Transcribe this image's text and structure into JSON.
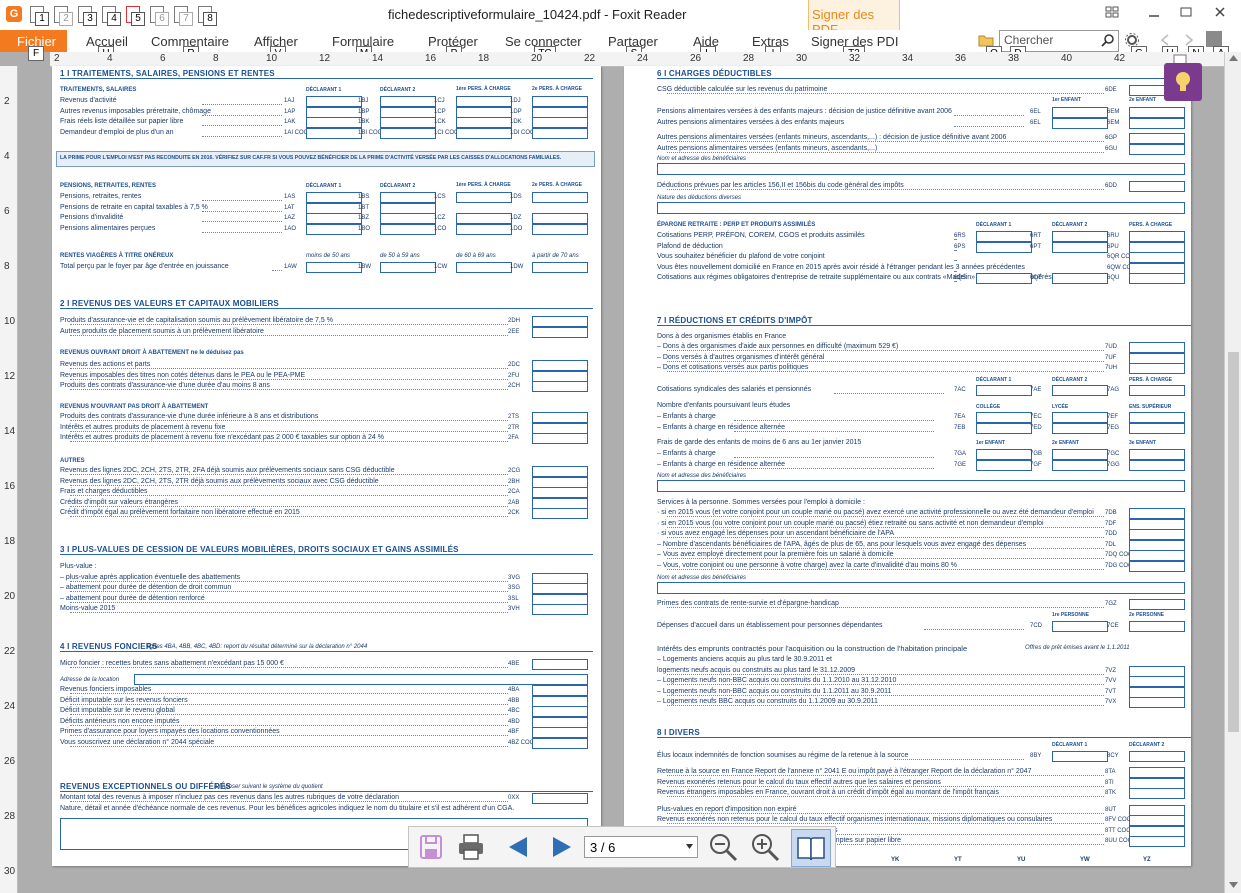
{
  "window": {
    "title": "fichedescriptiveformulaire_10424.pdf - Foxit Reader",
    "sign_tab": "Signer des PDF",
    "app_icon_letter": "G"
  },
  "qat_keys": [
    "1",
    "2",
    "3",
    "4",
    "5",
    "6",
    "7",
    "8"
  ],
  "menu": {
    "fichier": "Fichier",
    "items": [
      "Accueil",
      "Commentaire",
      "Afficher",
      "Formulaire",
      "Protéger",
      "Se connecter",
      "Partager",
      "Aide",
      "Extras",
      "Signer des PDI"
    ]
  },
  "menu_keytips": [
    "F",
    "H",
    "R",
    "V",
    "M",
    "P",
    "TC",
    "S",
    "L",
    "I",
    "T3",
    "Q",
    "D",
    "G",
    "U",
    "N",
    "A"
  ],
  "search": {
    "placeholder": "Chercher"
  },
  "ruler": {
    "h_ticks": [
      "2",
      "4",
      "6",
      "8",
      "10",
      "12",
      "14",
      "16",
      "18",
      "20",
      "22",
      "24",
      "26",
      "28",
      "30",
      "32",
      "34",
      "36",
      "38",
      "40",
      "42"
    ],
    "v_ticks": [
      "2",
      "4",
      "6",
      "8",
      "10",
      "12",
      "14",
      "16",
      "18",
      "20",
      "22",
      "24",
      "26",
      "28",
      "30"
    ]
  },
  "left_page": {
    "s1_title": "1 I TRAITEMENTS, SALAIRES, PENSIONS ET RENTES",
    "s1_sub": "TRAITEMENTS, SALAIRES",
    "col_heads": [
      "DÉCLARANT 1",
      "DÉCLARANT 2",
      "1ère PERS. À CHARGE",
      "2e PERS. À CHARGE"
    ],
    "s1_rows": [
      {
        "label": "Revenus d'activité",
        "codes": [
          "1AJ",
          "1BJ",
          "1CJ",
          "1DJ"
        ]
      },
      {
        "label": "Autres revenus imposables préretraite, chômage",
        "codes": [
          "1AP",
          "1BP",
          "1CP",
          "1DP"
        ]
      },
      {
        "label": "Frais réels liste détaillée sur papier libre",
        "codes": [
          "1AK",
          "1BK",
          "1CK",
          "1DK"
        ]
      },
      {
        "label": "Demandeur d'emploi de plus d'un an",
        "codes": [
          "1AI COCHEZ",
          "1BI COCHEZ",
          "1CI COCHEZ",
          "1DI COCHEZ"
        ]
      }
    ],
    "prime_note": "LA PRIME POUR L'EMPLOI N'EST PAS RECONDUITE EN 2016. VÉRIFIEZ SUR CAF.FR SI VOUS POUVEZ BÉNÉFICIER DE LA PRIME D'ACTIVITÉ VERSÉE PAR LES CAISSES D'ALLOCATIONS FAMILIALES.",
    "pensions_sub": "PENSIONS, RETRAITES, RENTES",
    "pensions_rows": [
      {
        "label": "Pensions, retraites, rentes",
        "codes": [
          "1AS",
          "1BS",
          "1CS",
          "1DS"
        ]
      },
      {
        "label": "Pensions de retraite en capital taxables à 7,5 %",
        "codes": [
          "1AT",
          "1BT",
          "",
          ""
        ]
      },
      {
        "label": "Pensions d'invalidité",
        "codes": [
          "1AZ",
          "1BZ",
          "1CZ",
          "1DZ"
        ]
      },
      {
        "label": "Pensions alimentaires perçues",
        "codes": [
          "1AO",
          "1BO",
          "1CO",
          "1DO"
        ]
      }
    ],
    "rentes_sub": "RENTES VIAGÈRES À TITRE ONÉREUX",
    "rentes_cols": [
      "moins de 50 ans",
      "de 50 à 59 ans",
      "de 60 à 69 ans",
      "à partir de 70 ans"
    ],
    "rentes_row": {
      "label": "Total perçu par le foyer par âge d'entrée en jouissance",
      "codes": [
        "1AW",
        "1BW",
        "1CW",
        "1DW"
      ]
    },
    "s2_title": "2 I REVENUS DES VALEURS ET CAPITAUX MOBILIERS",
    "s2_rows_a": [
      {
        "label": "Produits d'assurance-vie et de capitalisation soumis au prélèvement libératoire de 7,5 %",
        "code": "2DH"
      },
      {
        "label": "Autres produits de placement soumis à un prélèvement libératoire",
        "code": "2EE"
      }
    ],
    "s2_sub_b": "REVENUS OUVRANT DROIT À ABATTEMENT ne le déduisez pas",
    "s2_rows_b": [
      {
        "label": "Revenus des actions et parts",
        "code": "2DC"
      },
      {
        "label": "Revenus imposables des titres non cotés détenus dans le PEA ou le PEA-PME",
        "code": "2FU"
      },
      {
        "label": "Produits des contrats d'assurance-vie d'une durée d'au moins 8 ans",
        "code": "2CH"
      }
    ],
    "s2_sub_c": "REVENUS N'OUVRANT PAS DROIT À ABATTEMENT",
    "s2_rows_c": [
      {
        "label": "Produits des contrats d'assurance-vie d'une durée inférieure à 8 ans et distributions",
        "code": "2TS"
      },
      {
        "label": "Intérêts et autres produits de placement à revenu fixe",
        "code": "2TR"
      },
      {
        "label": "Intérêts et autres produits de placement à revenu fixe n'excédant pas 2 000 € taxables sur option à 24 %",
        "code": "2FA"
      }
    ],
    "s2_sub_d": "AUTRES",
    "s2_rows_d": [
      {
        "label": "Revenus des lignes 2DC, 2CH, 2TS, 2TR, 2FA déjà soumis aux prélèvements sociaux sans CSG déductible",
        "code": "2CG"
      },
      {
        "label": "Revenus des lignes 2DC, 2CH, 2TS, 2TR déjà soumis aux prélèvements sociaux avec CSG déductible",
        "code": "2BH"
      },
      {
        "label": "Frais et charges déductibles",
        "code": "2CA"
      },
      {
        "label": "Crédits d'impôt sur valeurs étrangères",
        "code": "2AB"
      },
      {
        "label": "Crédit d'impôt égal au prélèvement forfaitaire non libératoire effectué en 2015",
        "code": "2CK"
      }
    ],
    "s3_title": "3 I PLUS-VALUES DE CESSION DE VALEURS MOBILIÈRES, DROITS SOCIAUX ET GAINS ASSIMILÉS",
    "s3_rows": [
      {
        "label": "Plus-value :",
        "code": ""
      },
      {
        "label": "– plus-value après application éventuelle des abattements",
        "code": "3VG"
      },
      {
        "label": "– abattement pour durée de détention de droit commun",
        "code": "3SG"
      },
      {
        "label": "– abattement pour durée de détention renforcé",
        "code": "3SL"
      },
      {
        "label": "Moins-value 2015",
        "code": "3VH"
      }
    ],
    "s4_title": "4 I REVENUS FONCIERS",
    "s4_title_note": "lignes 4BA, 4BB, 4BC, 4BD: report du résultat déterminé sur la déclaration n° 2044",
    "s4_micro": {
      "label": "Micro foncier : recettes brutes sans abattement n'excédant pas 15 000 €",
      "code": "4BE"
    },
    "s4_address": "Adresse de la location",
    "s4_rows": [
      {
        "label": "Revenus fonciers imposables",
        "code": "4BA"
      },
      {
        "label": "Déficit imputable sur les revenus fonciers",
        "code": "4BB"
      },
      {
        "label": "Déficit imputable sur le revenu global",
        "code": "4BC"
      },
      {
        "label": "Déficits antérieurs non encore imputés",
        "code": "4BD"
      },
      {
        "label": "Primes d'assurance pour loyers impayés des locations conventionnées",
        "code": "4BF"
      },
      {
        "label": "Vous souscrivez une déclaration n° 2044 spéciale",
        "code": "4BZ COCHEZ"
      }
    ],
    "s5_title": "REVENUS EXCEPTIONNELS OU DIFFÉRÉS",
    "s5_title_note": "à imposer suivant le système du quotient",
    "s5_rows": [
      {
        "label": "Montant total des revenus à imposer n'incluez pas ces revenus dans les autres rubriques de votre déclaration",
        "code": "0XX"
      },
      {
        "label": "Nature, détail et année d'échéance normale de ces revenus. Pour les bénéfices agricoles indiquez le nom du titulaire et s'il est adhérent d'un CGA.",
        "code": ""
      }
    ]
  },
  "right_page": {
    "s6_title": "6 I CHARGES DÉDUCTIBLES",
    "csg": {
      "label": "CSG déductible calculée sur les revenus du patrimoine",
      "code": "6DE"
    },
    "enfant_cols": [
      "1er ENFANT",
      "2e ENFANT"
    ],
    "pensions_majeurs": [
      {
        "label": "Pensions alimentaires versées à des enfants majeurs : décision de justice définitive avant 2006",
        "codes": [
          "6EL",
          "6EM"
        ]
      },
      {
        "label": "Autres pensions alimentaires versées à des enfants majeurs",
        "codes": [
          "6EL",
          "6EM"
        ]
      }
    ],
    "autres_pensions": [
      {
        "label": "Autres pensions alimentaires versées (enfants mineurs, ascendants,...) : décision de justice définitive avant 2006",
        "code": "6GP"
      },
      {
        "label": "Autres pensions alimentaires versées (enfants mineurs, ascendants,...)",
        "code": "6GU"
      }
    ],
    "benef_note": "Nom et adresse des bénéficiaires",
    "deductions": {
      "label": "Déductions prévues par les articles 156,II et 156bis du code général des impôts",
      "code": "6DD"
    },
    "deductions_note": "Nature des déductions diverses",
    "epargne_sub": "ÉPARGNE RETRAITE : PERP ET PRODUITS ASSIMILÉS",
    "epargne_cols": [
      "DÉCLARANT 1",
      "DÉCLARANT 2",
      "PERS. À CHARGE"
    ],
    "epargne_rows": [
      {
        "label": "Cotisations PERP, PRÉFON, COREM, CGOS et produits assimilés",
        "codes": [
          "6RS",
          "6RT",
          "6RU"
        ]
      },
      {
        "label": "Plafond de déduction",
        "codes": [
          "6PS",
          "6PT",
          "6PU"
        ]
      },
      {
        "label": "Vous souhaitez bénéficier du plafond de votre conjoint",
        "codes": [
          "",
          "",
          "6QR COCHEZ"
        ]
      },
      {
        "label": "Vous êtes nouvellement domicilié en France en 2015 après avoir résidé à l'étranger pendant les 3 années précédentes",
        "codes": [
          "",
          "",
          "6QW COCHEZ"
        ]
      },
      {
        "label": "Cotisations aux régimes obligatoires d'entreprise de retraite supplémentaire ou aux contrats «Madelin» et versements exonérés sur un PERCO",
        "codes": [
          "6QS",
          "6QT",
          "6QU"
        ]
      }
    ],
    "s7_title": "7 I RÉDUCTIONS ET CRÉDITS D'IMPÔT",
    "dons_head": "Dons à des organismes établis en France",
    "dons_rows": [
      {
        "label": "– Dons à des organismes d'aide aux personnes en difficulté (maximum 529 €)",
        "code": "7UD"
      },
      {
        "label": "– Dons versés à d'autres organismes d'intérêt général",
        "code": "7UF"
      },
      {
        "label": "– Dons et cotisations versés aux partis politiques",
        "code": "7UH"
      }
    ],
    "cotis_cols": [
      "DÉCLARANT 1",
      "DÉCLARANT 2",
      "PERS. À CHARGE"
    ],
    "cotis_row": {
      "label": "Cotisations syndicales des salariés et pensionnés",
      "codes": [
        "7AC",
        "7AE",
        "7AG"
      ]
    },
    "etudes_head": "Nombre d'enfants poursuivant leurs études",
    "etudes_cols": [
      "COLLÈGE",
      "LYCÉE",
      "ENS. SUPÉRIEUR"
    ],
    "etudes_rows": [
      {
        "label": "– Enfants à charge",
        "codes": [
          "7EA",
          "7EC",
          "7EF"
        ]
      },
      {
        "label": "– Enfants à charge en résidence alternée",
        "codes": [
          "7EB",
          "7ED",
          "7EG"
        ]
      }
    ],
    "garde_head": "Frais de garde des enfants de moins de 6 ans au 1er janvier 2015",
    "garde_cols": [
      "1er ENFANT",
      "2e ENFANT",
      "3e ENFANT"
    ],
    "garde_rows": [
      {
        "label": "– Enfants à charge",
        "codes": [
          "7GA",
          "7GB",
          "7GC"
        ]
      },
      {
        "label": "– Enfants à charge en résidence alternée",
        "codes": [
          "7GE",
          "7GF",
          "7GG"
        ]
      }
    ],
    "garde_note": "Nom et adresse des bénéficiaires",
    "services_head": "Services à la personne. Sommes versées pour l'emploi à domicile :",
    "services_rows": [
      {
        "label": "· si en 2015 vous (et votre conjoint pour un couple marié ou pacsé) avez exercé une activité professionnelle ou avez été demandeur d'emploi",
        "code": "7DB"
      },
      {
        "label": "· si en 2015 vous (ou votre conjoint pour un couple marié ou pacsé) étiez retraité ou sans activité et non demandeur d'emploi",
        "code": "7DF"
      },
      {
        "label": "· si vous avez engagé les dépenses pour un ascendant bénéficiaire de l'APA",
        "code": "7DD"
      },
      {
        "label": "– Nombre d'ascendants bénéficiaires de l'APA, âgés de plus de 65, ans pour lesquels vous avez engagé des dépenses",
        "code": "7DL"
      },
      {
        "label": "– Vous avez employé directement pour la première fois un salarié à domicile",
        "code": "7DQ COCHEZ"
      },
      {
        "label": "– Vous, votre conjoint ou une personne à votre charge) avez la carte d'invalidité d'au moins 80 %",
        "code": "7DG COCHEZ"
      }
    ],
    "services_note": "Nom et adresse des bénéficiaires",
    "primes_row": {
      "label": "Primes des contrats de rente-survie et d'épargne-handicap",
      "code": "7GZ"
    },
    "accueil_cols": [
      "1re PERSONNE",
      "2e PERSONNE"
    ],
    "accueil_row": {
      "label": "Dépenses d'accueil dans un établissement pour personnes dépendantes",
      "codes": [
        "7CD",
        "7CE"
      ]
    },
    "interets_head": "Intérêts des emprunts contractés pour l'acquisition ou la construction de l'habitation principale",
    "interets_head_note": "Offres de prêt émises avant le 1.1.2011",
    "interets_rows": [
      {
        "label": "– Logements anciens acquis au plus tard le 30.9.2011 et",
        "code": ""
      },
      {
        "label": "logements neufs acquis ou construits au plus tard le 31.12.2009",
        "code": "7VZ"
      },
      {
        "label": "– Logements neufs non-BBC acquis ou construits du 1.1.2010 au 31.12.2010",
        "code": "7VV"
      },
      {
        "label": "– Logements neufs non-BBC acquis ou construits du 1.1.2011 au 30.9.2011",
        "code": "7VT"
      },
      {
        "label": "– Logements neufs BBC acquis ou construits du 1.1.2009 au 30.9.2011",
        "code": "7VX"
      }
    ],
    "s8_title": "8 I DIVERS",
    "divers_cols": [
      "DÉCLARANT 1",
      "DÉCLARANT 2"
    ],
    "elus_row": {
      "label": "Élus locaux indemnités de fonction soumises au régime de la retenue à la source",
      "codes": [
        "8BY",
        "8CY"
      ]
    },
    "divers_rows": [
      {
        "label": "Retenue à la source en France Report de l'annexe n° 2041 E ou impôt payé à l'étranger Report de la déclaration n° 2047",
        "code": "8TA"
      },
      {
        "label": "Revenus exonérés retenus pour le calcul du taux effectif autres que les salaires et pensions",
        "code": "8TI"
      },
      {
        "label": "Revenus étrangers imposables en France, ouvrant droit à un crédit d'impôt égal au montant de l'impôt français",
        "code": "8TK"
      },
      {
        "label": "Plus-values en report d'imposition non expiré",
        "code": "8UT"
      },
      {
        "label": "Revenus exonérés non retenus pour le calcul du taux effectif organismes internationaux, missions diplomatiques ou consulaires",
        "code": "8FV COCHEZ"
      },
      {
        "label": "Impatriés : revenus non imposables ... ... liste des contrats",
        "code": "8TT COCHEZ"
      },
      {
        "label": "Déposez-vous ... ... déclaration n° 3916 ou la liste des comptes sur papier libre",
        "code": "8UU COCHEZ"
      }
    ],
    "bottom_codes": [
      "YK",
      "YT",
      "YU",
      "YW",
      "YZ"
    ]
  },
  "float_toolbar": {
    "page_value": "3 / 6"
  }
}
